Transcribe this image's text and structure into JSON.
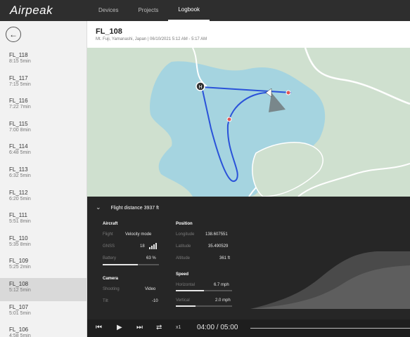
{
  "app": {
    "logo": "Airpeak"
  },
  "nav": {
    "tabs": [
      "Devices",
      "Projects",
      "Logbook"
    ],
    "active": "Logbook"
  },
  "sidebar": {
    "flights": [
      {
        "name": "FL_118",
        "time": "8:15  5min"
      },
      {
        "name": "FL_117",
        "time": "7:15  5min"
      },
      {
        "name": "FL_116",
        "time": "7:22  7min"
      },
      {
        "name": "FL_115",
        "time": "7:00  8min"
      },
      {
        "name": "FL_114",
        "time": "6:48  5min"
      },
      {
        "name": "FL_113",
        "time": "6:32  5min"
      },
      {
        "name": "FL_112",
        "time": "6:20  5min"
      },
      {
        "name": "FL_111",
        "time": "5:51  8min"
      },
      {
        "name": "FL_110",
        "time": "5:35  8min"
      },
      {
        "name": "FL_109",
        "time": "5:25  2min"
      },
      {
        "name": "FL_108",
        "time": "5:12  5min"
      },
      {
        "name": "FL_107",
        "time": "5:01  5min"
      },
      {
        "name": "FL_106",
        "time": "4:58  5min"
      }
    ],
    "selected_index": 10
  },
  "flight": {
    "title": "FL_108",
    "subtitle": "Mt. Fuji, Yamanashi, Japan  |  06/10/2021  5:12 AM - 5:17 AM"
  },
  "panel": {
    "distance_label": "Flight distance",
    "distance_value": "3937 ft",
    "aircraft": {
      "title": "Aircraft",
      "flight_label": "Flight",
      "flight_value": "Velocity mode",
      "gnss_label": "GNSS",
      "gnss_value": "18",
      "battery_label": "Battery",
      "battery_value": "63 %",
      "battery_level": 0.63
    },
    "camera": {
      "title": "Camera",
      "shooting_label": "Shooting",
      "shooting_value": "Video",
      "tilt_label": "Tilt",
      "tilt_value": "-10"
    },
    "position": {
      "title": "Position",
      "longitude_label": "Longitude",
      "longitude_value": "138.607551",
      "latitude_label": "Latitude",
      "latitude_value": "35.490529",
      "altitude_label": "Altitude",
      "altitude_value": "361 ft"
    },
    "speed": {
      "title": "Speed",
      "horizontal_label": "Horizontal",
      "horizontal_value": "6.7 mph",
      "horizontal_level": 0.5,
      "vertical_label": "Vertical",
      "vertical_value": "2.0 mph",
      "vertical_level": 0.35
    }
  },
  "playback": {
    "speed": "x1",
    "time": "04:00 / 05:00"
  },
  "colors": {
    "water": "#a5d4e0",
    "land": "#cfe0cf",
    "route": "#2a52d9"
  }
}
